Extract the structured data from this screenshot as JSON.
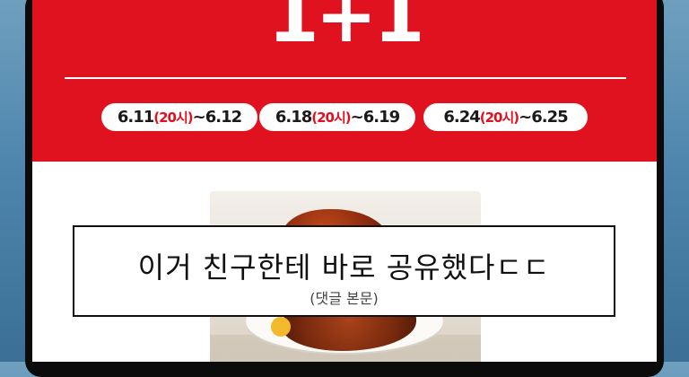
{
  "promo": {
    "title": "1+1",
    "colors": {
      "banner": "#e1121f",
      "text": "#ffffff",
      "hour_text": "#e1121f"
    }
  },
  "dates": [
    {
      "start": "6.11",
      "hour": "(20시)",
      "end": "~6.12"
    },
    {
      "start": "6.18",
      "hour": "(20시)",
      "end": "~6.19"
    },
    {
      "start": "6.24",
      "hour": "(20시)",
      "end": "~6.25"
    }
  ],
  "caption": {
    "main": "이거 친구한테 바로 공유했다ㄷㄷ",
    "sub": "(댓글 본문)"
  }
}
